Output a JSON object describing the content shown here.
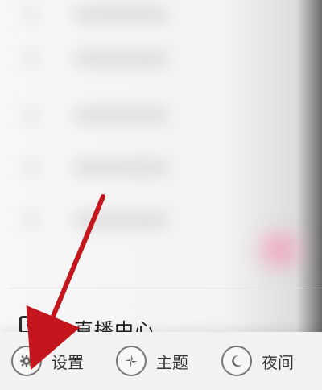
{
  "menu": {
    "live_center_label": "直播中心"
  },
  "bottom_bar": {
    "settings_label": "设置",
    "theme_label": "主题",
    "night_label": "夜间"
  },
  "icons": {
    "live_center": "camera-icon",
    "settings": "gear-icon",
    "theme": "theme-icon",
    "night": "moon-icon"
  },
  "colors": {
    "annotation_arrow": "#c4161c"
  }
}
